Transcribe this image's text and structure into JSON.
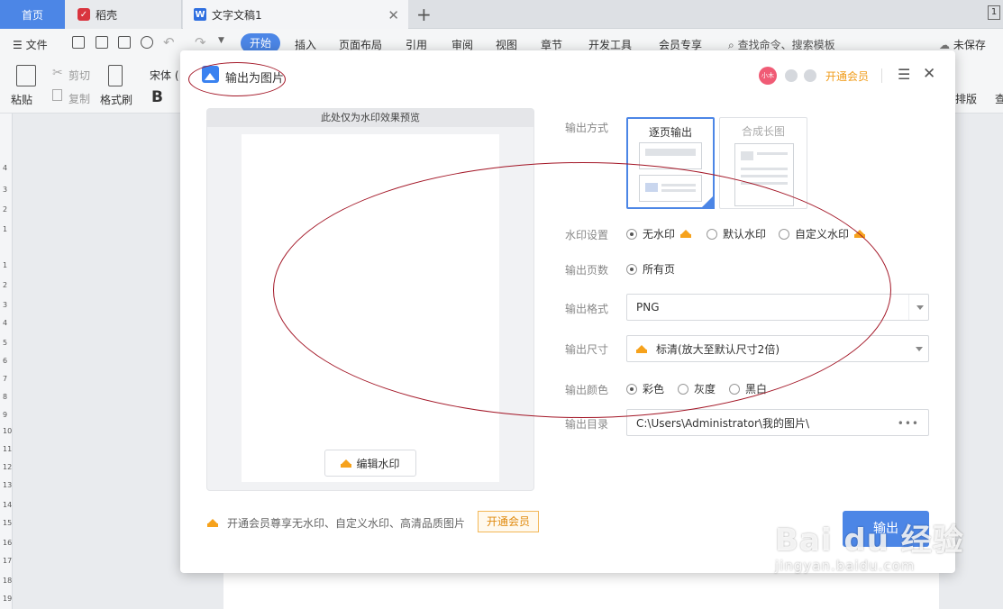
{
  "tabs": {
    "home": "首页",
    "docer": "稻壳",
    "document": "文字文稿1",
    "window_number": "1"
  },
  "menu": {
    "file": "文件",
    "items": [
      "开始",
      "插入",
      "页面布局",
      "引用",
      "审阅",
      "视图",
      "章节",
      "开发工具",
      "会员专享"
    ],
    "search": "查找命令、搜索模板",
    "unsaved": "未保存"
  },
  "ribbon": {
    "paste": "粘贴",
    "cut": "剪切",
    "copy": "复制",
    "format_painter": "格式刷",
    "font": "宋体 (",
    "bold": "B",
    "right_label": "排版",
    "right_label2": "查"
  },
  "dialog": {
    "title": "输出为图片",
    "avatar_text": "小木",
    "vip_link": "开通会员",
    "preview_header": "此处仅为水印效果预览",
    "edit_watermark": "编辑水印",
    "labels": {
      "mode": "输出方式",
      "watermark": "水印设置",
      "pages": "输出页数",
      "format": "输出格式",
      "size": "输出尺寸",
      "color": "输出颜色",
      "directory": "输出目录"
    },
    "modes": {
      "page": "逐页输出",
      "long": "合成长图"
    },
    "watermark_options": [
      "无水印",
      "默认水印",
      "自定义水印"
    ],
    "pages_option": "所有页",
    "format_value": "PNG",
    "size_value": "标清(放大至默认尺寸2倍)",
    "color_options": [
      "彩色",
      "灰度",
      "黑白"
    ],
    "directory_value": "C:\\Users\\Administrator\\我的图片\\",
    "directory_more": "•••",
    "footer_note": "开通会员尊享无水印、自定义水印、高清品质图片",
    "footer_vip": "开通会员",
    "export_button": "输出"
  },
  "watermark": {
    "main": "Bai du 经验",
    "sub": "jingyan.baidu.com"
  },
  "colors": {
    "accent": "#4c86e6",
    "vip": "#f09c1a",
    "annotation": "#a31626"
  }
}
